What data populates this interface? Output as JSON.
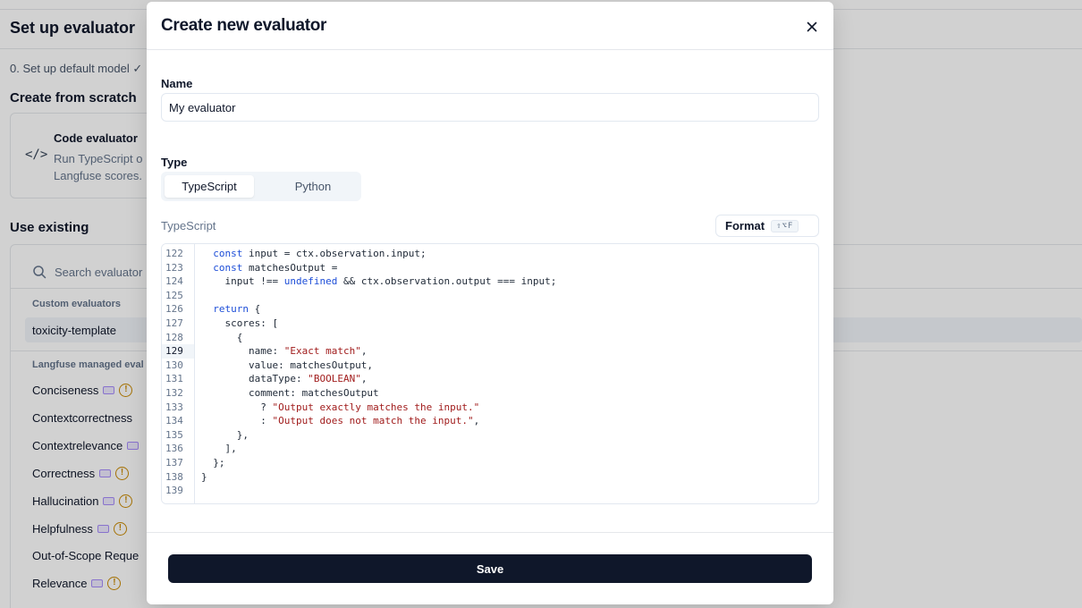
{
  "background": {
    "title": "Set up evaluator",
    "step": "0. Set up default model ✓",
    "create_section": "Create from scratch",
    "code_card": {
      "title": "Code evaluator",
      "desc_line1": "Run TypeScript o",
      "desc_line2": "Langfuse scores."
    },
    "existing_section": "Use existing",
    "search_placeholder": "Search evaluator",
    "custom_group": "Custom evaluators",
    "selected_item": "toxicity-template",
    "managed_group": "Langfuse managed eval",
    "items": [
      {
        "label": "Conciseness",
        "badge": true,
        "warn": true
      },
      {
        "label": "Contextcorrectness",
        "badge": false,
        "warn": false
      },
      {
        "label": "Contextrelevance",
        "badge": true,
        "warn": false
      },
      {
        "label": "Correctness",
        "badge": true,
        "warn": true
      },
      {
        "label": "Hallucination",
        "badge": true,
        "warn": true
      },
      {
        "label": "Helpfulness",
        "badge": true,
        "warn": true
      },
      {
        "label": "Out-of-Scope Reque",
        "badge": false,
        "warn": false
      },
      {
        "label": "Relevance",
        "badge": true,
        "warn": true
      }
    ]
  },
  "modal": {
    "title": "Create new evaluator",
    "name_label": "Name",
    "name_value": "My evaluator",
    "type_label": "Type",
    "type_options": [
      "TypeScript",
      "Python"
    ],
    "type_selected": "TypeScript",
    "language_label": "TypeScript",
    "format_label": "Format",
    "format_shortcut": "⇧⌥F",
    "code_lines": [
      {
        "n": "122",
        "html": "  <span class=\"kw\">const</span> input = ctx.observation.input;"
      },
      {
        "n": "123",
        "html": "  <span class=\"kw\">const</span> matchesOutput ="
      },
      {
        "n": "124",
        "html": "    input !== <span class=\"kw\">undefined</span> &amp;&amp; ctx.observation.output === input;"
      },
      {
        "n": "125",
        "html": ""
      },
      {
        "n": "126",
        "html": "  <span class=\"kw\">return</span> {"
      },
      {
        "n": "127",
        "html": "    scores: ["
      },
      {
        "n": "128",
        "html": "      {"
      },
      {
        "n": "129",
        "html": "        name: <span class=\"str\">\"Exact match\"</span>,"
      },
      {
        "n": "130",
        "html": "        value: matchesOutput,"
      },
      {
        "n": "131",
        "html": "        dataType: <span class=\"str\">\"BOOLEAN\"</span>,"
      },
      {
        "n": "132",
        "html": "        comment: matchesOutput"
      },
      {
        "n": "133",
        "html": "          ? <span class=\"str\">\"Output exactly matches the input.\"</span>"
      },
      {
        "n": "134",
        "html": "          : <span class=\"str\">\"Output does not match the input.\"</span>,"
      },
      {
        "n": "135",
        "html": "      },"
      },
      {
        "n": "136",
        "html": "    ],"
      },
      {
        "n": "137",
        "html": "  };"
      },
      {
        "n": "138",
        "html": "}"
      },
      {
        "n": "139",
        "html": ""
      }
    ],
    "active_line": "129",
    "save_label": "Save"
  }
}
